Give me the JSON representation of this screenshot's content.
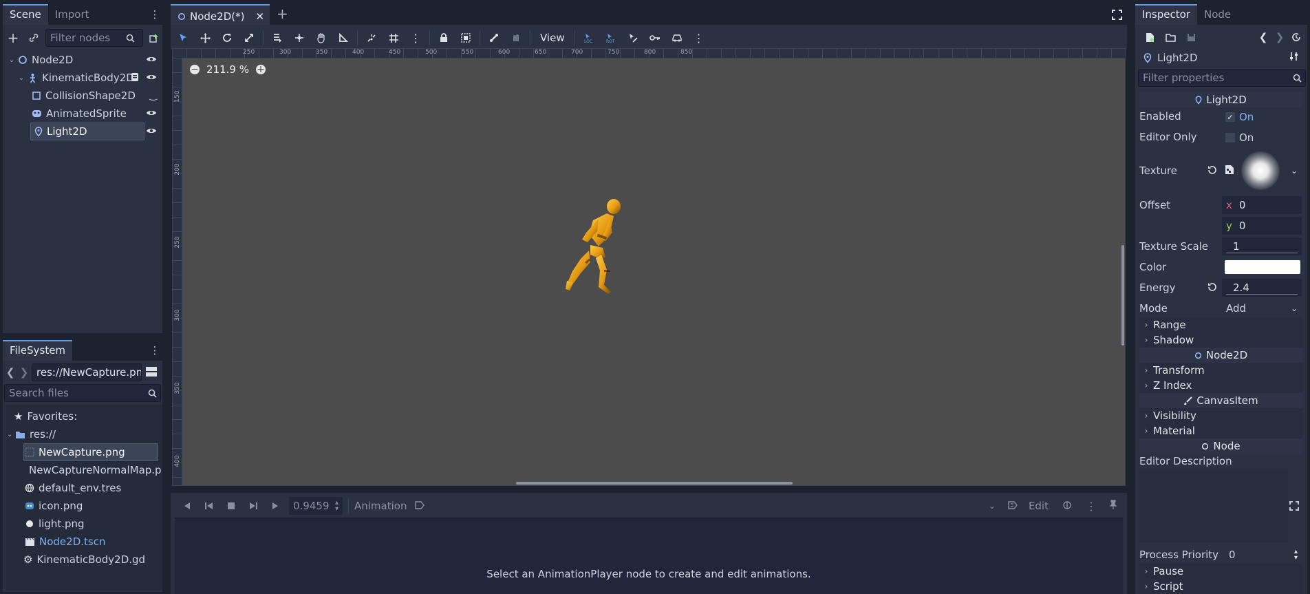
{
  "scene_dock": {
    "tabs": [
      "Scene",
      "Import"
    ],
    "filter_placeholder": "Filter nodes",
    "nodes": [
      {
        "label": "Node2D",
        "icon": "node2d-icon"
      },
      {
        "label": "KinematicBody2D",
        "icon": "kinematic-body-icon"
      },
      {
        "label": "CollisionShape2D",
        "icon": "collision-shape-icon"
      },
      {
        "label": "AnimatedSprite",
        "icon": "animated-sprite-icon"
      },
      {
        "label": "Light2D",
        "icon": "light2d-icon"
      }
    ]
  },
  "filesystem": {
    "tab": "FileSystem",
    "path": "res://NewCapture.png",
    "search_placeholder": "Search files",
    "favorites": "Favorites:",
    "root": "res://",
    "files": [
      {
        "label": "NewCapture.png",
        "icon": "image-icon"
      },
      {
        "label": "NewCaptureNormalMap.p",
        "icon": "image-icon"
      },
      {
        "label": "default_env.tres",
        "icon": "globe-icon"
      },
      {
        "label": "icon.png",
        "icon": "image-icon"
      },
      {
        "label": "light.png",
        "icon": "light-icon"
      },
      {
        "label": "Node2D.tscn",
        "icon": "scene-icon"
      },
      {
        "label": "KinematicBody2D.gd",
        "icon": "gear-icon"
      }
    ]
  },
  "editor": {
    "scene_tab": "Node2D(*)",
    "view_menu": "View",
    "zoom": "211.9 %",
    "ruler_top": [
      "250",
      "300",
      "350",
      "400",
      "450",
      "500",
      "550",
      "600",
      "650",
      "700",
      "750",
      "800",
      "850"
    ],
    "ruler_left": [
      "150",
      "200",
      "250",
      "300",
      "350",
      "400"
    ]
  },
  "animation": {
    "time": "0.9459",
    "label": "Animation",
    "edit": "Edit",
    "message": "Select an AnimationPlayer node to create and edit animations."
  },
  "inspector": {
    "tabs": [
      "Inspector",
      "Node"
    ],
    "object": "Light2D",
    "filter_placeholder": "Filter properties",
    "class_header": "Light2D",
    "enabled_label": "Enabled",
    "enabled_value": "On",
    "editor_only_label": "Editor Only",
    "editor_only_value": "On",
    "texture_label": "Texture",
    "offset_label": "Offset",
    "offset_x_axis": "x",
    "offset_x": "0",
    "offset_y_axis": "y",
    "offset_y": "0",
    "texture_scale_label": "Texture Scale",
    "texture_scale": "1",
    "color_label": "Color",
    "color_value": "#ffffff",
    "energy_label": "Energy",
    "energy": "2.4",
    "mode_label": "Mode",
    "mode": "Add",
    "range": "Range",
    "shadow": "Shadow",
    "node2d_header": "Node2D",
    "transform": "Transform",
    "z_index": "Z Index",
    "canvasitem_header": "CanvasItem",
    "visibility": "Visibility",
    "material": "Material",
    "node_header": "Node",
    "editor_description": "Editor Description",
    "process_priority_label": "Process Priority",
    "process_priority": "0",
    "pause": "Pause",
    "script": "Script"
  }
}
